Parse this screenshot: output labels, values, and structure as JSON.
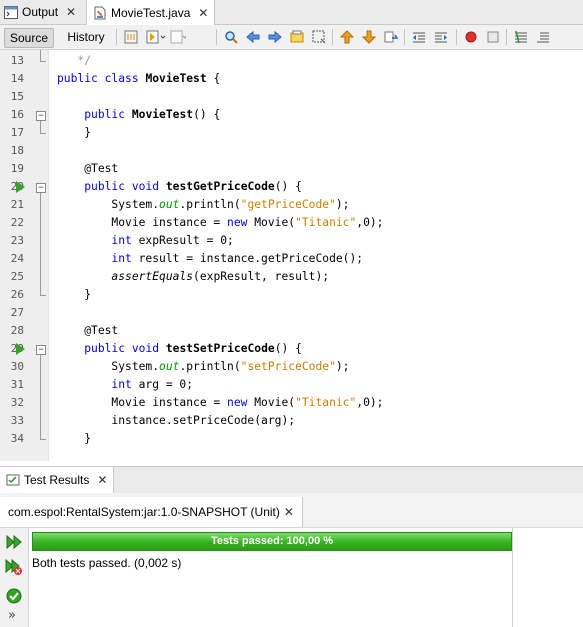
{
  "tabs": [
    {
      "label": "Output",
      "icon": "terminal-icon",
      "close": "✕"
    },
    {
      "label": "MovieTest.java",
      "icon": "java-file-icon",
      "close": "✕"
    }
  ],
  "toolbar": {
    "source_label": "Source",
    "history_label": "History",
    "icons": [
      "last-edit-icon",
      "back-icon",
      "forward-icon",
      "find-icon",
      "find-prev-icon",
      "find-next-icon",
      "toggle-highlight-icon",
      "select-rect-icon",
      "prev-bookmark-icon",
      "next-bookmark-icon",
      "toggle-bookmark-icon",
      "shift-left-icon",
      "shift-right-icon",
      "record-macro-icon",
      "stop-macro-icon",
      "comment-icon",
      "uncomment-icon"
    ]
  },
  "code": {
    "lines": [
      {
        "n": "13",
        "text": "   */"
      },
      {
        "n": "14",
        "text": "public class MovieTest {"
      },
      {
        "n": "15",
        "text": ""
      },
      {
        "n": "16",
        "text": "    public MovieTest() {"
      },
      {
        "n": "17",
        "text": "    }"
      },
      {
        "n": "18",
        "text": ""
      },
      {
        "n": "19",
        "text": "    @Test"
      },
      {
        "n": "20",
        "text": "    public void testGetPriceCode() {"
      },
      {
        "n": "21",
        "text": "        System.out.println(\"getPriceCode\");"
      },
      {
        "n": "22",
        "text": "        Movie instance = new Movie(\"Titanic\",0);"
      },
      {
        "n": "23",
        "text": "        int expResult = 0;"
      },
      {
        "n": "24",
        "text": "        int result = instance.getPriceCode();"
      },
      {
        "n": "25",
        "text": "        assertEquals(expResult, result);"
      },
      {
        "n": "26",
        "text": "    }"
      },
      {
        "n": "27",
        "text": ""
      },
      {
        "n": "28",
        "text": "    @Test"
      },
      {
        "n": "29",
        "text": "    public void testSetPriceCode() {"
      },
      {
        "n": "30",
        "text": "        System.out.println(\"setPriceCode\");"
      },
      {
        "n": "31",
        "text": "        int arg = 0;"
      },
      {
        "n": "32",
        "text": "        Movie instance = new Movie(\"Titanic\",0);"
      },
      {
        "n": "33",
        "text": "        instance.setPriceCode(arg);"
      },
      {
        "n": "34",
        "text": "    }"
      }
    ]
  },
  "test_results": {
    "tab_label": "Test Results",
    "tab_close": "✕",
    "session_label": "com.espol:RentalSystem:jar:1.0-SNAPSHOT (Unit)",
    "session_close": "✕",
    "progress_label": "Tests passed: 100,00 %",
    "progress_fraction": 1.0,
    "summary": "Both tests passed. (0,002 s)",
    "side_icons": [
      "rerun-icon",
      "rerun-failed-icon",
      "show-passed-icon",
      "show-more-icon"
    ],
    "more_glyph": "»"
  },
  "colors": {
    "keyword": "#0000e6",
    "string": "#ce7b00",
    "field": "#009900",
    "progress": "#36b21f"
  }
}
